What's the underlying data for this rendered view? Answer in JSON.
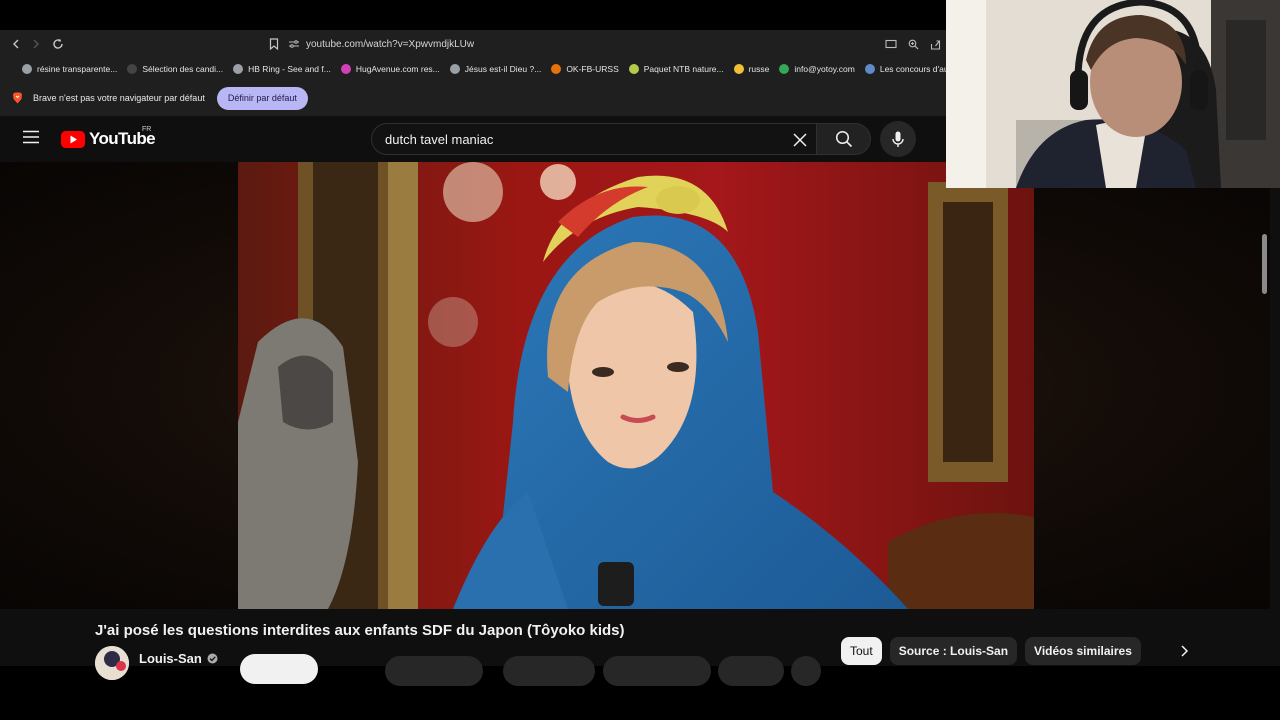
{
  "browser": {
    "url": "youtube.com/watch?v=XpwvmdjkLUw",
    "bookmarks": [
      {
        "label": "résine transparente...",
        "color": "#9aa0a6"
      },
      {
        "label": "Sélection des candi...",
        "color": "#444444"
      },
      {
        "label": "HB Ring - See and f...",
        "color": "#9aa0a6"
      },
      {
        "label": "HugAvenue.com res...",
        "color": "#d33fb7"
      },
      {
        "label": "Jésus est-il Dieu ?...",
        "color": "#9aa0a6"
      },
      {
        "label": "OK-FB-URSS",
        "color": "#e8710a"
      },
      {
        "label": "Paquet NTB nature...",
        "color": "#b5c94a"
      },
      {
        "label": "russe",
        "color": "#f2c037"
      },
      {
        "label": "info@yotoy.com",
        "color": "#34a853"
      },
      {
        "label": "Les concours d'aute...",
        "color": "#5f8ac7"
      }
    ],
    "infobar": {
      "message": "Brave n'est pas votre navigateur par défaut",
      "button": "Définir par défaut"
    }
  },
  "youtube": {
    "logo": "YouTube",
    "region": "FR",
    "search": {
      "query": "dutch tavel maniac"
    },
    "video": {
      "title": "J'ai posé les questions interdites aux enfants SDF du Japon (Tôyoko kids)",
      "channel": "Louis-San"
    },
    "chips": [
      {
        "label": "Tout",
        "active": true
      },
      {
        "label": "Source : Louis-San",
        "active": false
      },
      {
        "label": "Vidéos similaires",
        "active": false
      }
    ]
  },
  "colors": {
    "yt_background": "#0f0f0f",
    "yt_red": "#ff0000",
    "brave_accent": "#b9b6f5"
  }
}
